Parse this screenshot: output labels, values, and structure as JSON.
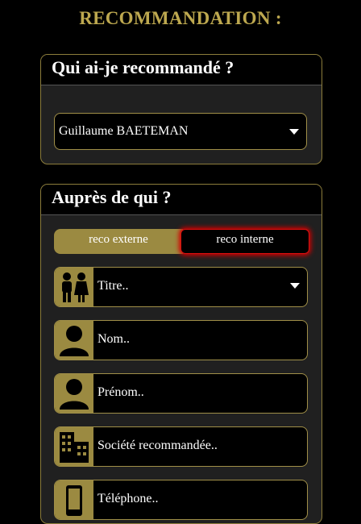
{
  "page": {
    "title": "RECOMMANDATION :"
  },
  "section_who": {
    "title": "Qui ai-je recommandé ?",
    "selected": "Guillaume BAETEMAN"
  },
  "section_to": {
    "title": "Auprès de qui ?",
    "toggle": {
      "external": "reco externe",
      "internal": "reco interne"
    },
    "fields": {
      "title": "Titre..",
      "lastname": "Nom..",
      "firstname": "Prénom..",
      "company": "Société recommandée..",
      "phone": "Téléphone.."
    }
  },
  "icons": [
    "people-icon",
    "person-icon",
    "person-icon",
    "building-icon",
    "phone-icon"
  ],
  "colors": {
    "accent": "#9b8a41",
    "title_gold": "#bda84f",
    "active_border": "#e01010"
  }
}
